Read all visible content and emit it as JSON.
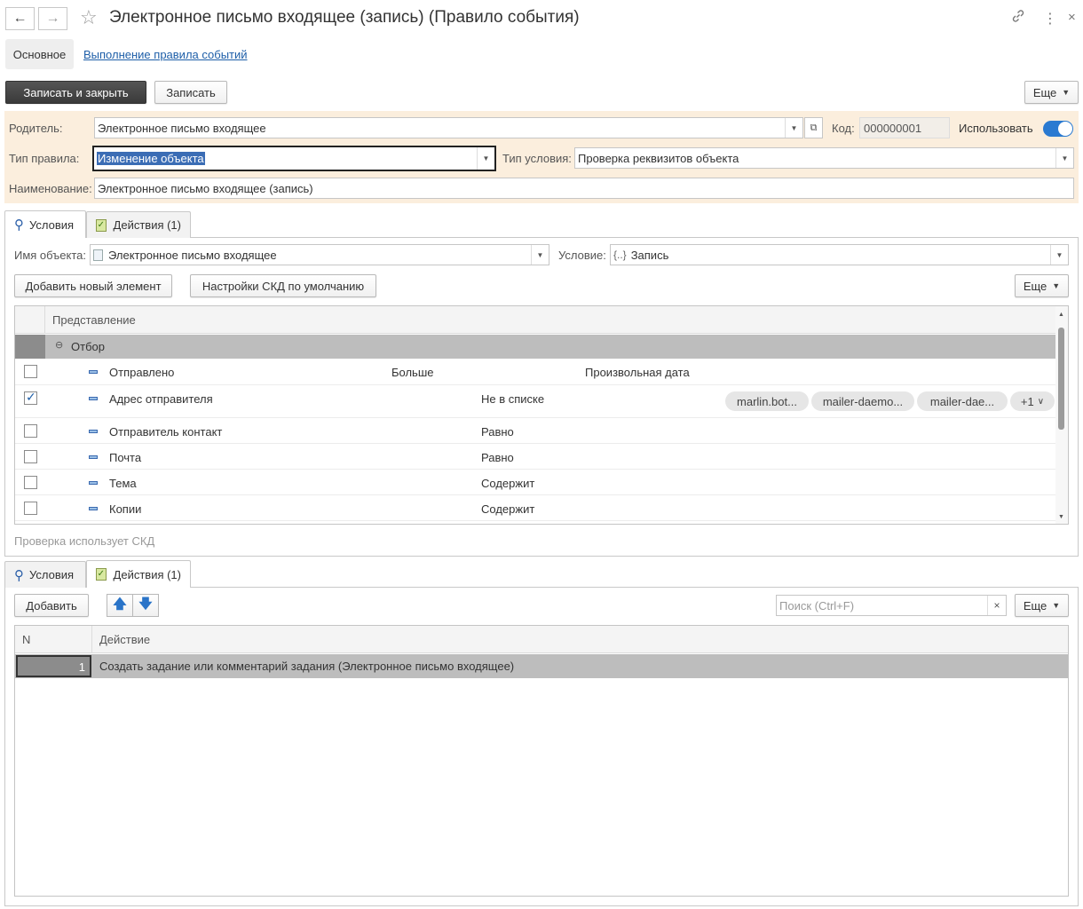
{
  "window": {
    "title": "Электронное письмо входящее (запись) (Правило события)",
    "back_icon": "arrow-left-icon",
    "forward_icon": "arrow-right-icon",
    "favorite_icon": "star-icon",
    "link_icon": "link-icon",
    "menu_icon": "more-vertical-icon",
    "close_icon": "close-icon"
  },
  "nav_tabs": {
    "main": "Основное",
    "link": "Выполнение правила событий"
  },
  "toolbar": {
    "save_close": "Записать и закрыть",
    "save": "Записать",
    "more": "Еще"
  },
  "form": {
    "parent_label": "Родитель:",
    "parent_value": "Электронное письмо входящее",
    "code_label": "Код:",
    "code_value": "000000001",
    "use_label": "Использовать",
    "use_enabled": true,
    "rule_type_label": "Тип правила:",
    "rule_type_value": "Изменение объекта",
    "condition_type_label": "Тип условия:",
    "condition_type_value": "Проверка реквизитов объекта",
    "name_label": "Наименование:",
    "name_value": "Электронное письмо входящее (запись)"
  },
  "tabs": {
    "conditions": "Условия",
    "actions": "Действия (1)"
  },
  "conditions": {
    "object_label": "Имя объекта:",
    "object_value": "Электронное письмо входящее",
    "condition_label": "Условие:",
    "condition_value": "Запись",
    "add_button": "Добавить новый элемент",
    "settings_button": "Настройки СКД по умолчанию",
    "more": "Еще",
    "column_header": "Представление",
    "group_label": "Отбор",
    "rows": [
      {
        "name": "Отправлено",
        "checked": false,
        "op": "Больше",
        "value": "Произвольная дата"
      },
      {
        "name": "Адрес отправителя",
        "checked": true,
        "op": "Не в списке",
        "value": ""
      },
      {
        "name": "Отправитель контакт",
        "checked": false,
        "op": "Равно",
        "value": ""
      },
      {
        "name": "Почта",
        "checked": false,
        "op": "Равно",
        "value": ""
      },
      {
        "name": "Тема",
        "checked": false,
        "op": "Содержит",
        "value": ""
      },
      {
        "name": "Копии",
        "checked": false,
        "op": "Содержит",
        "value": ""
      }
    ],
    "pills": [
      "marlin.bot...",
      "mailer-daemo...",
      "mailer-dae...",
      "+1"
    ],
    "footer_note": "Проверка использует СКД"
  },
  "actions": {
    "add_button": "Добавить",
    "search_placeholder": "Поиск (Ctrl+F)",
    "more": "Еще",
    "col_n": "N",
    "col_action": "Действие",
    "rows": [
      {
        "n": "1",
        "action": "Создать задание или комментарий задания (Электронное письмо входящее)"
      }
    ]
  },
  "colors": {
    "header_bg": "#fbeedd",
    "accent": "#2a7ad1",
    "link": "#1d5ea8",
    "group_row": "#bdbdbd"
  }
}
